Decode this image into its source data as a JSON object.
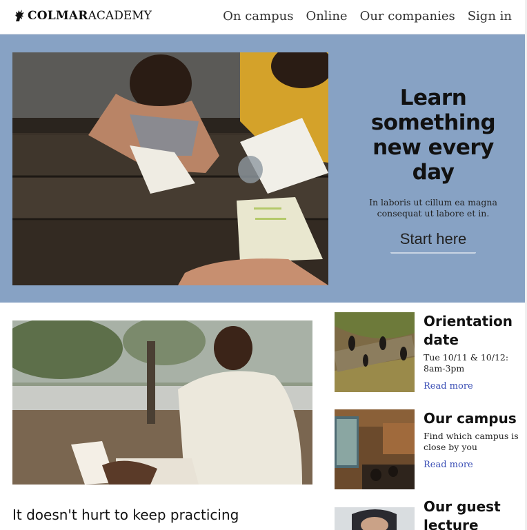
{
  "header": {
    "logo_bold": "COLMAR",
    "logo_light": "ACADEMY",
    "nav": {
      "on_campus": "On campus",
      "online": "Online",
      "companies": "Our companies",
      "sign_in": "Sign in"
    }
  },
  "hero": {
    "title_lines": [
      "Learn",
      "something",
      "new every",
      "day"
    ],
    "subtitle": "In laboris ut cillum ea magna consequat ut labore et in.",
    "button": "Start here",
    "image_alt": "students-studying-at-picnic-table"
  },
  "article": {
    "title": "It doesn't hurt to keep practicing",
    "image_alt": "man-reading-book-outdoors"
  },
  "cards": [
    {
      "title": "Orientation date",
      "text": "Tue 10/11 & 10/12: 8am-3pm",
      "link": "Read more"
    },
    {
      "title": "Our campus",
      "text": "Find which campus is close by you",
      "link": "Read more"
    },
    {
      "title": "Our guest lecture",
      "text": "",
      "link": ""
    }
  ],
  "colors": {
    "hero_bg": "#87a2c4",
    "link": "#3b4fb5",
    "text": "#111111"
  },
  "icons": {
    "logo": "griffin-icon"
  }
}
